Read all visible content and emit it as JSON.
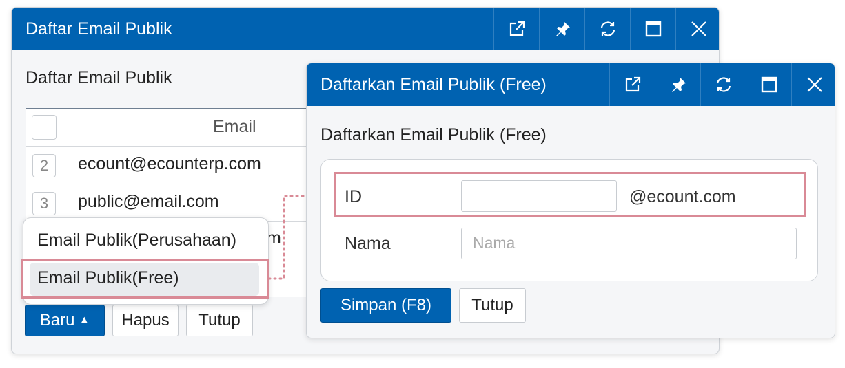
{
  "window_main": {
    "title": "Daftar Email Publik",
    "section_title": "Daftar Email Publik",
    "column_email": "Email",
    "rows": [
      {
        "num": "2",
        "email": "ecount@ecounterp.com"
      },
      {
        "num": "3",
        "email": "public@email.com"
      },
      {
        "partial": "m"
      }
    ],
    "buttons": {
      "new": "Baru",
      "delete": "Hapus",
      "close": "Tutup"
    },
    "dropdown": [
      "Email Publik(Perusahaan)",
      "Email Publik(Free)"
    ]
  },
  "window_dialog": {
    "title": "Daftarkan Email Publik (Free)",
    "section_title": "Daftarkan Email Publik (Free)",
    "id_label": "ID",
    "id_suffix": "@ecount.com",
    "name_label": "Nama",
    "name_placeholder": "Nama",
    "buttons": {
      "save": "Simpan (F8)",
      "close": "Tutup"
    }
  },
  "titlebar_icons": [
    "popout-icon",
    "pin-icon",
    "refresh-icon",
    "maximize-icon",
    "close-icon"
  ],
  "colors": {
    "titlebar": "#0062b1",
    "highlight": "#d98a96"
  }
}
